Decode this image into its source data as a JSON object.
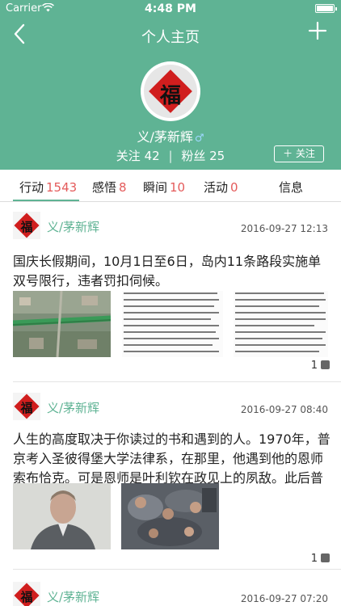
{
  "status_bar": {
    "carrier": "Carrier",
    "wifi_icon": "wifi-icon",
    "time": "4:48 PM",
    "battery_icon": "battery-icon"
  },
  "nav": {
    "back_icon": "chevron-left-icon",
    "back_glyph": "〈",
    "title": "个人主页",
    "add_icon": "plus-icon",
    "add_glyph": "+"
  },
  "profile": {
    "avatar_icon": "fu-character-avatar",
    "avatar_char": "福",
    "name": "义/茅新辉",
    "gender_icon": "male-icon",
    "gender_glyph": "♂",
    "following_label": "关注",
    "following_count": "42",
    "separator": "|",
    "fans_label": "粉丝",
    "fans_count": "25",
    "follow_button": "＋ 关注"
  },
  "tabs": [
    {
      "label": "行动",
      "count": "1543",
      "active": true
    },
    {
      "label": "感悟",
      "count": "8"
    },
    {
      "label": "瞬间",
      "count": "10"
    },
    {
      "label": "活动",
      "count": "0"
    },
    {
      "label": "信息",
      "count": ""
    }
  ],
  "posts": [
    {
      "author": "义/茅新辉",
      "date": "2016-09-27 12:13",
      "text": "国庆长假期间，10月1日至6日，岛内11条路段实施单双号限行，违者罚扣伺候。",
      "likes": "1",
      "images": [
        "aerial-road-map",
        "traffic-notice-document",
        "bus-notice-document"
      ]
    },
    {
      "author": "义/茅新辉",
      "date": "2016-09-27 08:40",
      "text": "人生的高度取决于你读过的书和遇到的人。1970年，普京考入圣彼得堡大学法律系，在那里，他遇到他的恩师索布恰克。可是恩师是叶利钦在政见上的夙敌。此后普京忠...",
      "likes": "1",
      "images": [
        "man-portrait-photo",
        "crowd-scene-photo"
      ]
    },
    {
      "author": "义/茅新辉",
      "date": "2016-09-27 07:20"
    }
  ],
  "colors": {
    "brand_green": "#5fb394",
    "count_red": "#e45b5b",
    "fu_red": "#d01e1e"
  }
}
